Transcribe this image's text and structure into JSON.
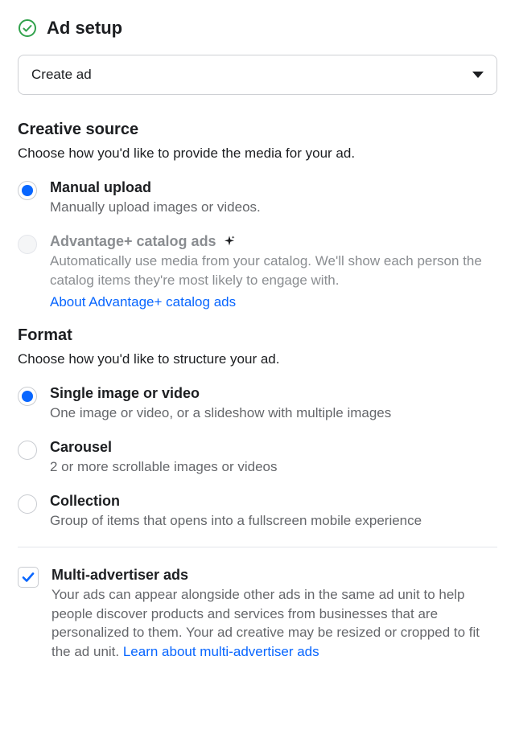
{
  "header": {
    "title": "Ad setup",
    "dropdown_label": "Create ad"
  },
  "creative_source": {
    "title": "Creative source",
    "subtitle": "Choose how you'd like to provide the media for your ad.",
    "options": {
      "manual": {
        "title": "Manual upload",
        "desc": "Manually upload images or videos.",
        "selected": true
      },
      "advantage": {
        "title": "Advantage+ catalog ads",
        "desc": "Automatically use media from your catalog. We'll show each person the catalog items they're most likely to engage with.",
        "link": "About Advantage+ catalog ads",
        "disabled": true
      }
    }
  },
  "format": {
    "title": "Format",
    "subtitle": "Choose how you'd like to structure your ad.",
    "options": {
      "single": {
        "title": "Single image or video",
        "desc": "One image or video, or a slideshow with multiple images",
        "selected": true
      },
      "carousel": {
        "title": "Carousel",
        "desc": "2 or more scrollable images or videos"
      },
      "collection": {
        "title": "Collection",
        "desc": "Group of items that opens into a fullscreen mobile experience"
      }
    }
  },
  "multi_advertiser": {
    "title": "Multi-advertiser ads",
    "desc": "Your ads can appear alongside other ads in the same ad unit to help people discover products and services from businesses that are personalized to them. Your ad creative may be resized or cropped to fit the ad unit. ",
    "link": "Learn about multi-advertiser ads",
    "checked": true
  }
}
